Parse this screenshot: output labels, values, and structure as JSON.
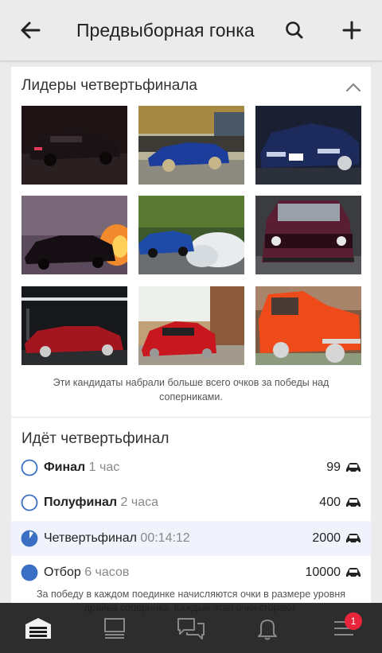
{
  "header": {
    "title": "Предвыборная гонка",
    "back_icon": "arrow-left-icon",
    "search_icon": "search-icon",
    "add_icon": "plus-icon"
  },
  "leaders": {
    "title": "Лидеры четвертьфинала",
    "caption": "Эти кандидаты набрали больше всего очков за победы над соперниками.",
    "photos": [
      {
        "name": "dark-sedan-photo"
      },
      {
        "name": "blue-sedan-photo"
      },
      {
        "name": "navy-sports-coupe-photo"
      },
      {
        "name": "sunset-sedan-photo"
      },
      {
        "name": "drifting-car-photo"
      },
      {
        "name": "maroon-hatchback-photo"
      },
      {
        "name": "red-sedan-garage-photo"
      },
      {
        "name": "red-sports-car-photo"
      },
      {
        "name": "orange-hatchback-photo"
      }
    ]
  },
  "stages": {
    "title": "Идёт четвертьфинал",
    "items": [
      {
        "label": "Финал",
        "time": "1 час",
        "score": "99",
        "bold": true,
        "state": "empty"
      },
      {
        "label": "Полуфинал",
        "time": "2 часа",
        "score": "400",
        "bold": true,
        "state": "empty"
      },
      {
        "label": "Четвертьфинал",
        "time": "00:14:12",
        "score": "2000",
        "bold": false,
        "state": "partial",
        "progress": 0.9
      },
      {
        "label": "Отбор",
        "time": "6 часов",
        "score": "10000",
        "bold": false,
        "state": "full"
      }
    ],
    "footnote": "За победу в каждом поединке начисляются очки в размере уровня драйва соперника. Каждый этап очки сгорают."
  },
  "nav": {
    "badge": "1",
    "items": [
      "garage-icon",
      "feed-icon",
      "messages-icon",
      "notifications-icon",
      "menu-icon"
    ]
  },
  "colors": {
    "accent": "#3a6fc4",
    "badge": "#e8253b",
    "header_bg": "#ebebeb"
  }
}
